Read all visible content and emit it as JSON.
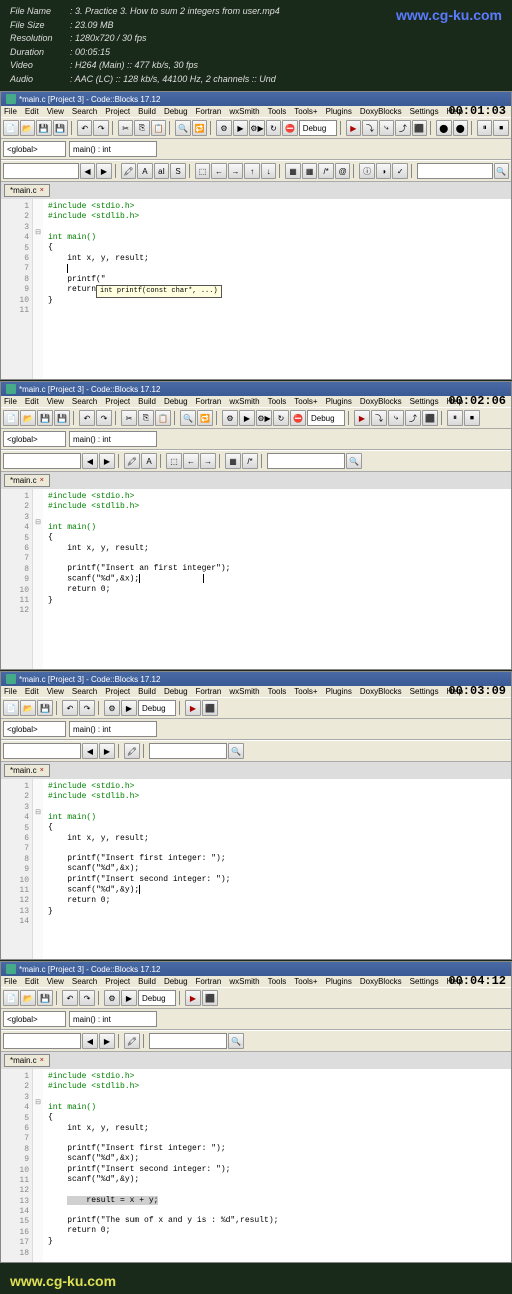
{
  "info": {
    "filename_label": "File Name",
    "filename": ": 3. Practice 3. How to sum 2 integers from user.mp4",
    "filesize_label": "File Size",
    "filesize": ": 23.09 MB",
    "resolution_label": "Resolution",
    "resolution": ": 1280x720 / 30 fps",
    "duration_label": "Duration",
    "duration": ": 00:05:15",
    "video_label": "Video",
    "video": ": H264 (Main) :: 477 kb/s, 30 fps",
    "audio_label": "Audio",
    "audio": ": AAC (LC) :: 128 kb/s, 44100 Hz, 2 channels :: Und"
  },
  "watermark_top": "www.cg-ku.com",
  "watermark_bottom": "www.cg-ku.com",
  "title": "*main.c [Project 3] - Code::Blocks 17.12",
  "menu": [
    "File",
    "Edit",
    "View",
    "Search",
    "Project",
    "Build",
    "Debug",
    "Fortran",
    "wxSmith",
    "Tools",
    "Tools+",
    "Plugins",
    "DoxyBlocks",
    "Settings",
    "Help"
  ],
  "target": "Debug",
  "scope_global": "<global>",
  "scope_func": "main() : int",
  "tab_name": "*main.c",
  "timestamps": [
    "00:01:03",
    "00:02:06",
    "00:03:09",
    "00:04:12"
  ],
  "frame1": {
    "lines": {
      "l1": "#include <stdio.h>",
      "l2": "#include <stdlib.h>",
      "l4": "int main()",
      "l6": "    int x, y, result;",
      "l8": "    printf(\"",
      "l9": "    return",
      "hint": "int printf(const char*, ...)"
    }
  },
  "frame2": {
    "lines": {
      "l1": "#include <stdio.h>",
      "l2": "#include <stdlib.h>",
      "l4": "int main()",
      "l6": "    int x, y, result;",
      "l8": "    printf(\"Insert an first integer\");",
      "l9": "    scanf(\"%d\",&x);",
      "l10": "    return 0;"
    }
  },
  "frame3": {
    "lines": {
      "l1": "#include <stdio.h>",
      "l2": "#include <stdlib.h>",
      "l4": "int main()",
      "l6": "    int x, y, result;",
      "l8": "    printf(\"Insert first integer: \");",
      "l9": "    scanf(\"%d\",&x);",
      "l10": "    printf(\"Insert second integer: \");",
      "l11": "    scanf(\"%d\",&y);",
      "l12": "    return 0;"
    }
  },
  "frame4": {
    "lines": {
      "l1": "#include <stdio.h>",
      "l2": "#include <stdlib.h>",
      "l4": "int main()",
      "l6": "    int x, y, result;",
      "l8": "    printf(\"Insert first integer: \");",
      "l9": "    scanf(\"%d\",&x);",
      "l10": "    printf(\"Insert second integer: \");",
      "l11": "    scanf(\"%d\",&y);",
      "l13": "    result = x + y;",
      "l15": "    printf(\"The sum of x and y is : %d\",result);",
      "l16": "    return 0;"
    }
  }
}
